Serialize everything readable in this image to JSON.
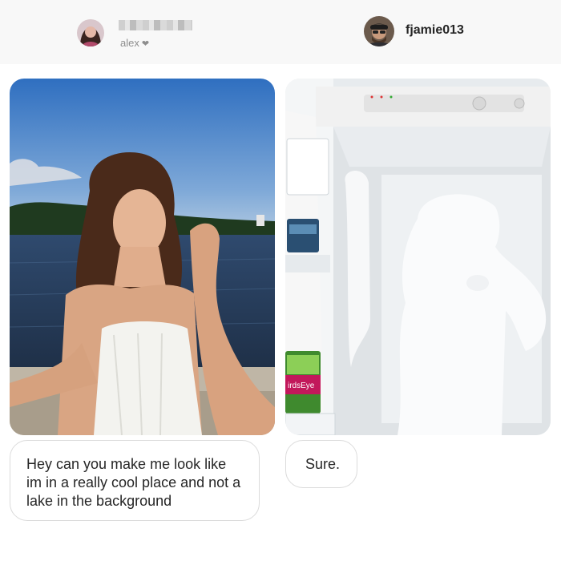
{
  "header": {
    "left_user": {
      "sub_label": "alex",
      "avatar": "avatar-girl",
      "heart_icon": "heart-icon"
    },
    "right_user": {
      "username": "fjamie013",
      "avatar": "avatar-man"
    }
  },
  "photos": {
    "left": {
      "subject": "girl-by-lake-photo"
    },
    "right": {
      "subject": "open-freezer-photo",
      "package_text": "irdsEye"
    }
  },
  "messages": {
    "left": "Hey can you make me look like im in a really cool place and not a lake in the background",
    "right": "Sure."
  },
  "colors": {
    "sky": "#3d78c4",
    "lake": "#2a3f5c",
    "freezer": "#eef2f5",
    "text": "#262626",
    "muted": "#8e8e8e"
  }
}
